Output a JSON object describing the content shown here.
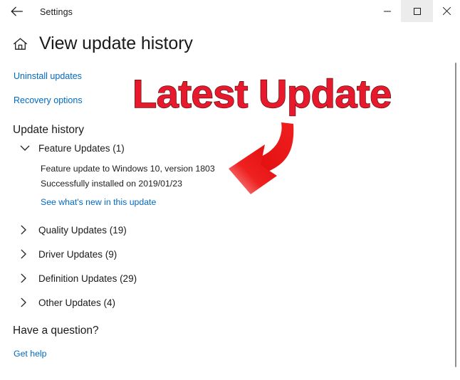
{
  "titlebar": {
    "back_icon": "back-arrow-icon",
    "title": "Settings",
    "minimize_label": "‒",
    "maximize_label": "☐",
    "close_label": "✕"
  },
  "page": {
    "home_icon": "home-icon",
    "title": "View update history"
  },
  "links": {
    "uninstall_updates": "Uninstall updates",
    "recovery_options": "Recovery options"
  },
  "update_history": {
    "section_title": "Update history",
    "groups": [
      {
        "label": "Feature Updates (1)",
        "expanded": true,
        "chevron": "chevron-down-icon"
      },
      {
        "label": "Quality Updates (19)",
        "expanded": false,
        "chevron": "chevron-right-icon"
      },
      {
        "label": "Driver Updates (9)",
        "expanded": false,
        "chevron": "chevron-right-icon"
      },
      {
        "label": "Definition Updates (29)",
        "expanded": false,
        "chevron": "chevron-right-icon"
      },
      {
        "label": "Other Updates (4)",
        "expanded": false,
        "chevron": "chevron-right-icon"
      }
    ],
    "feature_update": {
      "name": "Feature update to Windows 10, version 1803",
      "status": "Successfully installed on 2019/01/23",
      "whats_new_link": "See what's new in this update"
    }
  },
  "footer": {
    "question_title": "Have a question?",
    "get_help_link": "Get help"
  },
  "annotation": {
    "text": "Latest Update",
    "arrow_icon": "curved-arrow-icon",
    "color": "#e8192c",
    "outline_color": "#5a1010"
  },
  "colors": {
    "link": "#0069c0",
    "text": "#1a1a1a",
    "background": "#ffffff",
    "scrollbar": "#8e8e8e",
    "window_button_hover": "#ececec"
  }
}
